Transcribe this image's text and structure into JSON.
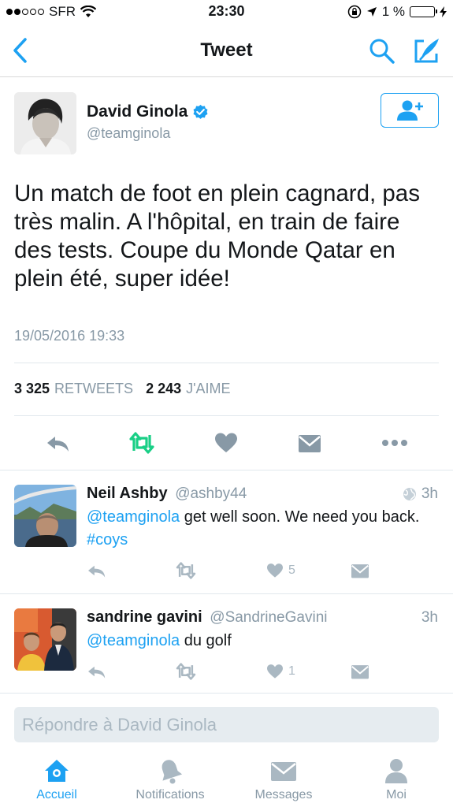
{
  "status_bar": {
    "carrier": "SFR",
    "time": "23:30",
    "battery": "1 %"
  },
  "nav": {
    "title": "Tweet"
  },
  "tweet": {
    "author_name": "David Ginola",
    "author_handle": "@teamginola",
    "text": "Un match de foot en plein cagnard, pas très malin. A l'hôpital, en train de faire des tests. Coupe du Monde Qatar en plein été, super idée!",
    "date": "19/05/2016 19:33",
    "retweets_count": "3 325",
    "retweets_label": "RETWEETS",
    "likes_count": "2 243",
    "likes_label": "J'AIME"
  },
  "replies": [
    {
      "name": "Neil Ashby",
      "handle": "@ashby44",
      "time": "3h",
      "mention": "@teamginola",
      "text": " get well soon. We need you back. ",
      "hashtag": "#coys",
      "likes": "5"
    },
    {
      "name": "sandrine gavini",
      "handle": "@SandrineGavini",
      "time": "3h",
      "mention": "@teamginola",
      "text": " du golf",
      "hashtag": "",
      "likes": "1"
    }
  ],
  "reply_input": {
    "placeholder": "Répondre à David Ginola"
  },
  "tabs": [
    {
      "label": "Accueil",
      "icon": "home-icon",
      "active": true
    },
    {
      "label": "Notifications",
      "icon": "bell-icon",
      "active": false
    },
    {
      "label": "Messages",
      "icon": "envelope-icon",
      "active": false
    },
    {
      "label": "Moi",
      "icon": "person-icon",
      "active": false
    }
  ],
  "colors": {
    "accent": "#1da1f2",
    "retweet_green": "#19cf86",
    "muted": "#8899a6",
    "icon_gray": "#aab8c2"
  }
}
